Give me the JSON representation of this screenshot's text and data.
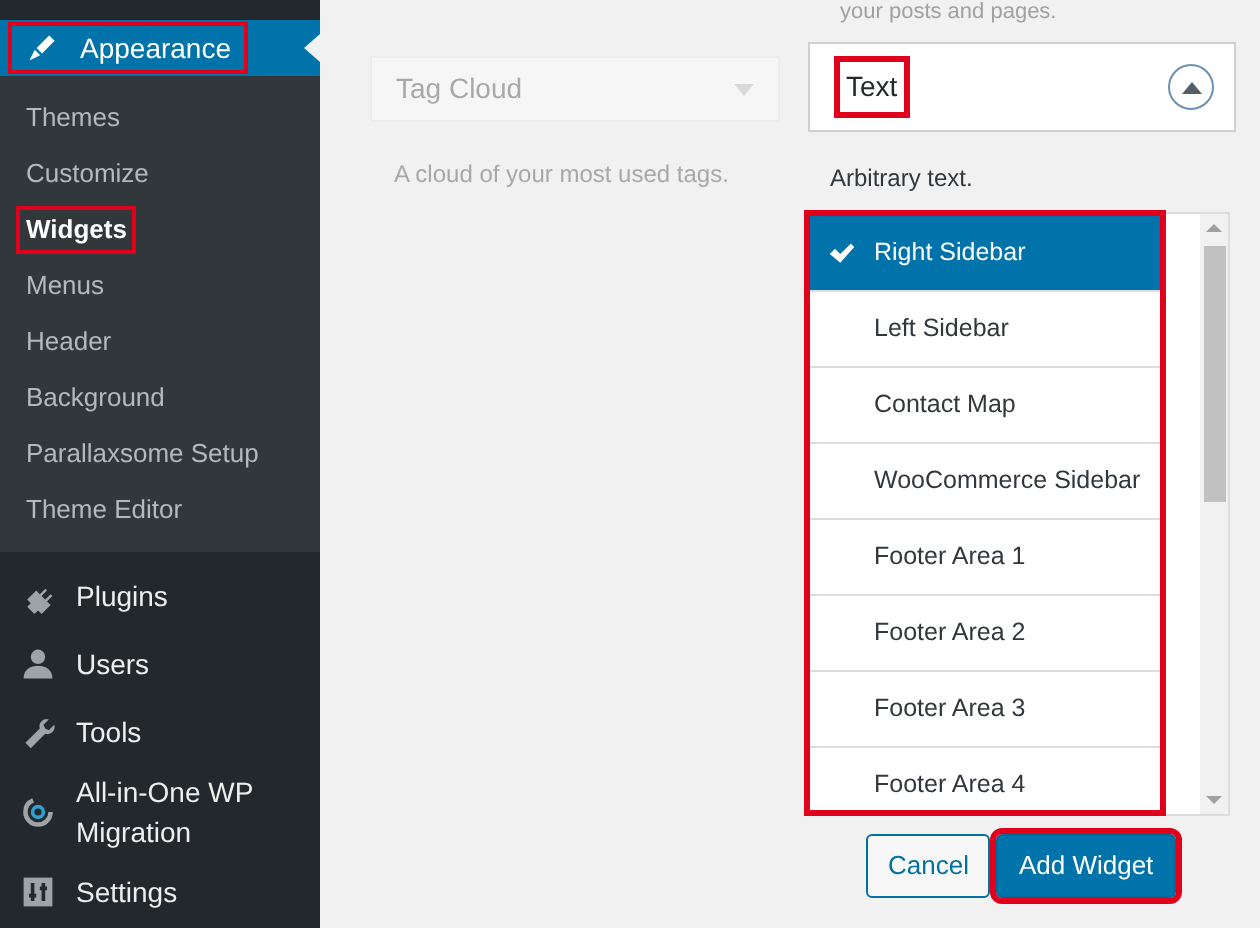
{
  "sidebar": {
    "active_menu": {
      "label": "Appearance",
      "highlighted": true,
      "submenu": [
        {
          "label": "Themes",
          "selected": false,
          "highlighted": false
        },
        {
          "label": "Customize",
          "selected": false,
          "highlighted": false
        },
        {
          "label": "Widgets",
          "selected": true,
          "highlighted": true
        },
        {
          "label": "Menus",
          "selected": false,
          "highlighted": false
        },
        {
          "label": "Header",
          "selected": false,
          "highlighted": false
        },
        {
          "label": "Background",
          "selected": false,
          "highlighted": false
        },
        {
          "label": "Parallaxsome Setup",
          "selected": false,
          "highlighted": false
        },
        {
          "label": "Theme Editor",
          "selected": false,
          "highlighted": false
        }
      ]
    },
    "items": [
      {
        "label": "Plugins",
        "kind": "plug"
      },
      {
        "label": "Users",
        "kind": "user"
      },
      {
        "label": "Tools",
        "kind": "wrench"
      },
      {
        "label": "All-in-One WP Migration",
        "kind": "migration"
      },
      {
        "label": "Settings",
        "kind": "settings"
      }
    ]
  },
  "background_widget": {
    "cut_description": "your posts and pages.",
    "title": "Tag Cloud",
    "description": "A cloud of your most used tags."
  },
  "widget": {
    "title": "Text",
    "title_highlighted": true,
    "expanded": true,
    "description": "Arbitrary text.",
    "sidebar_list": {
      "highlighted": true,
      "items": [
        {
          "label": "Right Sidebar",
          "selected": true
        },
        {
          "label": "Left Sidebar",
          "selected": false
        },
        {
          "label": "Contact Map",
          "selected": false
        },
        {
          "label": "WooCommerce Sidebar",
          "selected": false
        },
        {
          "label": "Footer Area 1",
          "selected": false
        },
        {
          "label": "Footer Area 2",
          "selected": false
        },
        {
          "label": "Footer Area 3",
          "selected": false
        },
        {
          "label": "Footer Area 4",
          "selected": false
        }
      ]
    },
    "buttons": [
      {
        "label": "Cancel",
        "kind": "secondary",
        "highlighted": false
      },
      {
        "label": "Add Widget",
        "kind": "primary",
        "highlighted": true
      }
    ]
  }
}
